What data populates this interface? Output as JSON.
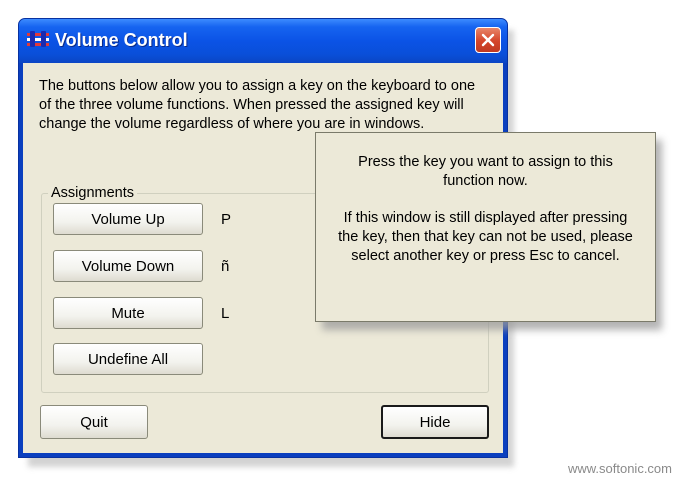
{
  "window": {
    "title": "Volume Control",
    "description": "The buttons below allow you to assign a key on the keyboard to one of the three volume functions. When pressed the assigned key will change the volume regardless of where you are in windows."
  },
  "assignments": {
    "legend": "Assignments",
    "rows": [
      {
        "button": "Volume Up",
        "key": "P"
      },
      {
        "button": "Volume Down",
        "key": "ñ"
      },
      {
        "button": "Mute",
        "key": "L"
      }
    ],
    "undefine_all": "Undefine All"
  },
  "buttons": {
    "quit": "Quit",
    "hide": "Hide"
  },
  "popup": {
    "line1": "Press the key you want to assign to this function now.",
    "line2": "If this window is still displayed after pressing the key, then that key can not be used, please select another key or press Esc to cancel."
  },
  "watermark": "www.softonic.com",
  "colors": {
    "titlebar": "#0b53e6",
    "close_button": "#d4452a",
    "client_bg": "#ece9d8"
  },
  "icons": {
    "app": "volume-control-icon",
    "close": "close-icon"
  }
}
